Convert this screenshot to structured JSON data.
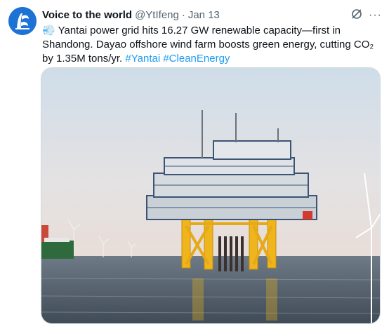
{
  "tweet": {
    "author_name": "Voice to the world",
    "handle": "@YtIfeng",
    "separator": "·",
    "date": "Jan 13",
    "line1_emoji": "💨",
    "line1": "Yantai power grid hits 16.27 GW renewable capacity—first in Shandong.",
    "line2": "Dayao offshore wind farm boosts green energy, cutting CO₂ by 1.35M",
    "line3": "tons/yr.",
    "hashtags": [
      "#Yantai",
      "#CleanEnergy"
    ]
  },
  "icons": {
    "grok": "grok-icon",
    "more": "more-icon"
  },
  "colors": {
    "link": "#1d9bf0",
    "muted": "#536471",
    "avatar_bg": "#1d72d6"
  }
}
